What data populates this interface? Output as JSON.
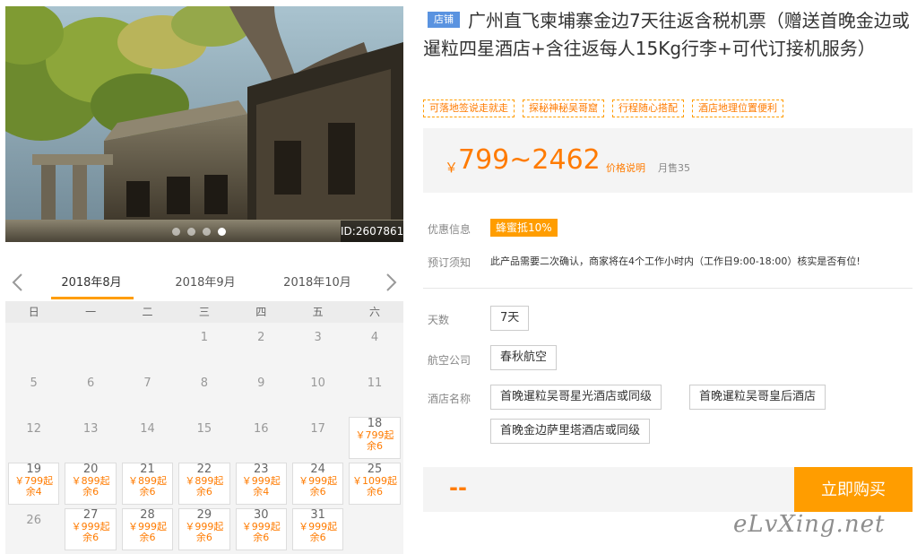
{
  "gallery": {
    "image_id": "ID:2607861",
    "dot_count": 4,
    "active_dot": 3
  },
  "calendar": {
    "months": [
      "2018年8月",
      "2018年9月",
      "2018年10月"
    ],
    "active_month": 0,
    "weekdays": [
      "日",
      "一",
      "二",
      "三",
      "四",
      "五",
      "六"
    ],
    "rows": [
      [
        {
          "d": ""
        },
        {
          "d": ""
        },
        {
          "d": ""
        },
        {
          "d": "1"
        },
        {
          "d": "2"
        },
        {
          "d": "3"
        },
        {
          "d": "4"
        }
      ],
      [
        {
          "d": "5"
        },
        {
          "d": "6"
        },
        {
          "d": "7"
        },
        {
          "d": "8"
        },
        {
          "d": "9"
        },
        {
          "d": "10"
        },
        {
          "d": "11"
        }
      ],
      [
        {
          "d": "12"
        },
        {
          "d": "13"
        },
        {
          "d": "14"
        },
        {
          "d": "15"
        },
        {
          "d": "16"
        },
        {
          "d": "17"
        },
        {
          "d": "18",
          "p": "￥799起",
          "s": "余6"
        }
      ],
      [
        {
          "d": "19",
          "p": "￥799起",
          "s": "余4"
        },
        {
          "d": "20",
          "p": "￥899起",
          "s": "余6"
        },
        {
          "d": "21",
          "p": "￥899起",
          "s": "余6"
        },
        {
          "d": "22",
          "p": "￥899起",
          "s": "余6"
        },
        {
          "d": "23",
          "p": "￥999起",
          "s": "余4"
        },
        {
          "d": "24",
          "p": "￥999起",
          "s": "余6"
        },
        {
          "d": "25",
          "p": "￥1099起",
          "s": "余6"
        }
      ],
      [
        {
          "d": "26"
        },
        {
          "d": "27",
          "p": "￥999起",
          "s": "余6"
        },
        {
          "d": "28",
          "p": "￥999起",
          "s": "余6"
        },
        {
          "d": "29",
          "p": "￥999起",
          "s": "余6"
        },
        {
          "d": "30",
          "p": "￥999起",
          "s": "余6"
        },
        {
          "d": "31",
          "p": "￥999起",
          "s": "余6"
        },
        {
          "d": ""
        }
      ]
    ]
  },
  "product": {
    "shop_tag": "店铺",
    "title": "广州直飞柬埔寨金边7天往返含税机票（赠送首晚金边或暹粒四星酒店+含往返每人15Kg行李+可代订接机服务）",
    "tags": [
      "可落地签说走就走",
      "探秘神秘吴哥窟",
      "行程随心搭配",
      "酒店地理位置便利"
    ],
    "currency": "￥",
    "price_range": "799~2462",
    "price_note": "价格说明",
    "monthly_sales": "月售35"
  },
  "info": {
    "promo_label": "优惠信息",
    "promo_badge": "蜂蜜抵10%",
    "notice_label": "预订须知",
    "notice_text": "此产品需要二次确认，商家将在4个工作小时内（工作日9:00-18:00）核实是否有位!"
  },
  "options": {
    "days_label": "天数",
    "days": [
      "7天"
    ],
    "airline_label": "航空公司",
    "airlines": [
      "春秋航空"
    ],
    "hotel_label": "酒店名称",
    "hotels": [
      "首晚暹粒吴哥星光酒店或同级",
      "首晚暹粒吴哥皇后酒店",
      "首晚金边萨里塔酒店或同级"
    ]
  },
  "buy": {
    "total": "--",
    "button_label": "立即购买"
  },
  "watermark": "eLvXing.net",
  "colors": {
    "accent": "#ff9d00",
    "price": "#ff7b00",
    "shop_tag": "#5a93e0"
  }
}
